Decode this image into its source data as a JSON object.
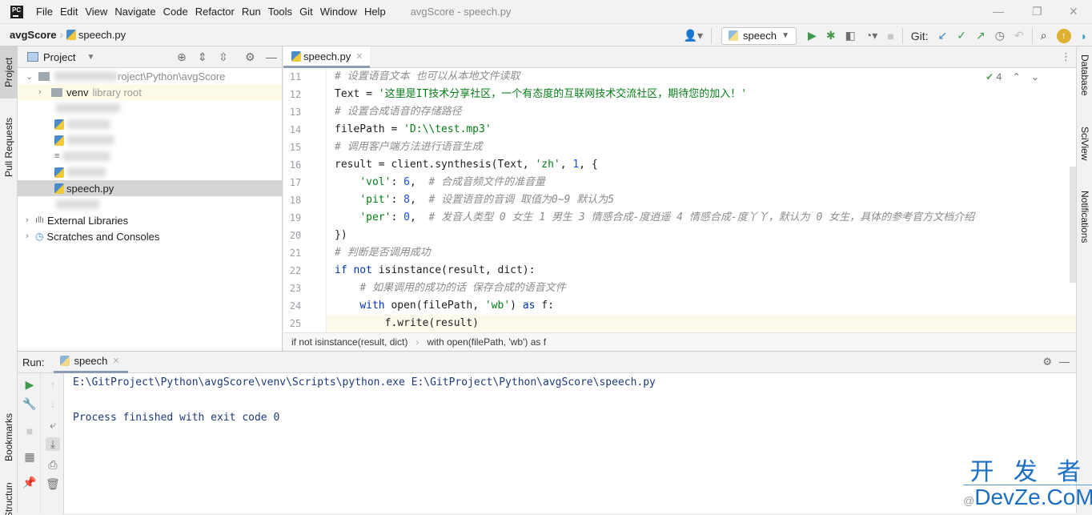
{
  "window": {
    "title": "avgScore - speech.py",
    "controls": [
      "minimize",
      "restore",
      "close"
    ]
  },
  "menu": [
    "File",
    "Edit",
    "View",
    "Navigate",
    "Code",
    "Refactor",
    "Run",
    "Tools",
    "Git",
    "Window",
    "Help"
  ],
  "navbar": {
    "project": "avgScore",
    "file": "speech.py"
  },
  "toolbar": {
    "run_config": "speech",
    "git_label": "Git:"
  },
  "left_strip": {
    "tabs": [
      "Project",
      "Pull Requests",
      "Bookmarks",
      "Structure"
    ]
  },
  "right_strip": {
    "tabs": [
      "Database",
      "SciView",
      "Notifications"
    ]
  },
  "project_panel": {
    "title": "Project",
    "root_path_suffix": "roject\\Python\\avgScore",
    "items": [
      {
        "name": "venv",
        "hint": "library root"
      },
      {
        "name": "speech.py",
        "selected": true
      },
      {
        "name": "External Libraries"
      },
      {
        "name": "Scratches and Consoles"
      }
    ]
  },
  "editor": {
    "tab": "speech.py",
    "inspection_count": "4",
    "lines": [
      {
        "n": "11",
        "text": "# 设置语音文本 也可以从本地文件读取"
      },
      {
        "n": "12",
        "text": "Text = '这里是IT技术分享社区，一个有态度的互联网技术交流社区，期待您的加入！'"
      },
      {
        "n": "13",
        "text": "# 设置合成语音的存储路径"
      },
      {
        "n": "14",
        "text": "filePath = 'D:\\\\test.mp3'"
      },
      {
        "n": "15",
        "text": "# 调用客户端方法进行语音生成"
      },
      {
        "n": "16",
        "text": "result = client.synthesis(Text, 'zh', 1, {"
      },
      {
        "n": "17",
        "text": "    'vol': 6,  # 合成音频文件的准音量"
      },
      {
        "n": "18",
        "text": "    'pit': 8,  # 设置语音的音调 取值为0~9 默认为5"
      },
      {
        "n": "19",
        "text": "    'per': 0,  # 发音人类型 0 女生 1 男生 3 情感合成-度逍遥 4 情感合成-度丫丫，默认为 0 女生，具体的参考官方文档介绍"
      },
      {
        "n": "20",
        "text": "})"
      },
      {
        "n": "21",
        "text": "# 判断是否调用成功"
      },
      {
        "n": "22",
        "text": "if not isinstance(result, dict):"
      },
      {
        "n": "23",
        "text": "    # 如果调用的成功的话 保存合成的语音文件"
      },
      {
        "n": "24",
        "text": "    with open(filePath, 'wb') as f:"
      },
      {
        "n": "25",
        "text": "        f.write(result)"
      }
    ],
    "breadcrumb": [
      "if not isinstance(result, dict)",
      "with open(filePath, 'wb') as f"
    ]
  },
  "run_panel": {
    "label": "Run:",
    "tab": "speech",
    "output": [
      "E:\\GitProject\\Python\\avgScore\\venv\\Scripts\\python.exe E:\\GitProject\\Python\\avgScore\\speech.py",
      "",
      "Process finished with exit code 0"
    ]
  },
  "watermark": {
    "top": "开 发 者",
    "bottom": "DevZe.CoM",
    "prefix": "@"
  }
}
